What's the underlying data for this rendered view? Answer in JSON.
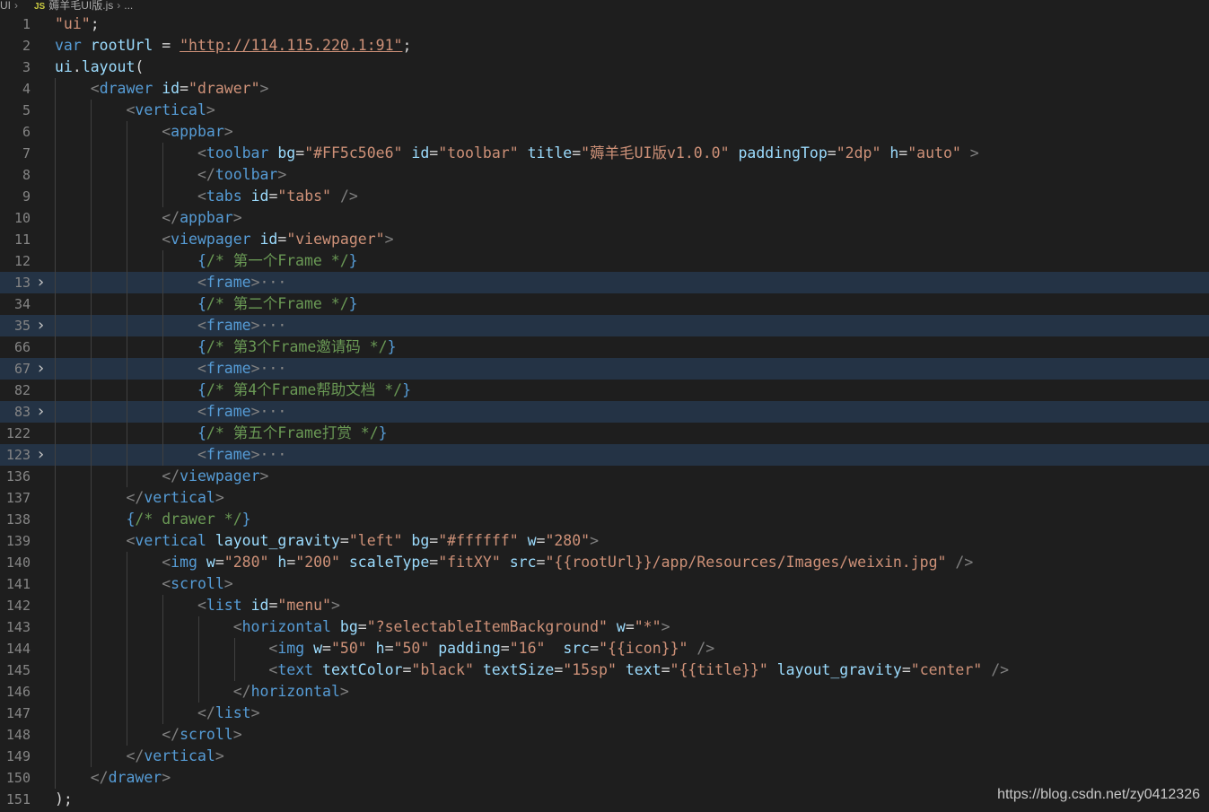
{
  "breadcrumb": {
    "root": "UI",
    "file_badge": "JS",
    "file": "薅羊毛UI版.js",
    "more": "..."
  },
  "colors": {
    "background": "#1e1e1e",
    "folded_line_bg": "#243345",
    "tag": "#569cd6",
    "attribute": "#9cdcfe",
    "string": "#ce9178",
    "comment": "#6a9955",
    "punctuation": "#808080"
  },
  "lines": [
    {
      "n": "1",
      "tokens": [
        [
          "st",
          "\"ui\""
        ],
        [
          "pl",
          ";"
        ]
      ]
    },
    {
      "n": "2",
      "tokens": [
        [
          "kw",
          "var"
        ],
        [
          "pl",
          " "
        ],
        [
          "vr",
          "rootUrl"
        ],
        [
          "pl",
          " = "
        ],
        [
          "st ul",
          "\"http://114.115.220.1:91\""
        ],
        [
          "pl",
          ";"
        ]
      ]
    },
    {
      "n": "3",
      "tokens": [
        [
          "vr",
          "ui"
        ],
        [
          "pl",
          "."
        ],
        [
          "vr",
          "layout"
        ],
        [
          "pl",
          "("
        ]
      ]
    },
    {
      "n": "4",
      "tokens": [
        [
          "pl",
          "    "
        ],
        [
          "tg",
          "<"
        ],
        [
          "tn",
          "drawer"
        ],
        [
          "pl",
          " "
        ],
        [
          "at",
          "id"
        ],
        [
          "pl",
          "="
        ],
        [
          "st",
          "\"drawer\""
        ],
        [
          "tg",
          ">"
        ]
      ]
    },
    {
      "n": "5",
      "tokens": [
        [
          "pl",
          "        "
        ],
        [
          "tg",
          "<"
        ],
        [
          "tn",
          "vertical"
        ],
        [
          "tg",
          ">"
        ]
      ]
    },
    {
      "n": "6",
      "tokens": [
        [
          "pl",
          "            "
        ],
        [
          "tg",
          "<"
        ],
        [
          "tn",
          "appbar"
        ],
        [
          "tg",
          ">"
        ]
      ]
    },
    {
      "n": "7",
      "tokens": [
        [
          "pl",
          "                "
        ],
        [
          "tg",
          "<"
        ],
        [
          "tn",
          "toolbar"
        ],
        [
          "pl",
          " "
        ],
        [
          "at",
          "bg"
        ],
        [
          "pl",
          "="
        ],
        [
          "st",
          "\"#FF5c50e6\""
        ],
        [
          "pl",
          " "
        ],
        [
          "at",
          "id"
        ],
        [
          "pl",
          "="
        ],
        [
          "st",
          "\"toolbar\""
        ],
        [
          "pl",
          " "
        ],
        [
          "at",
          "title"
        ],
        [
          "pl",
          "="
        ],
        [
          "st",
          "\"薅羊毛UI版v1.0.0\""
        ],
        [
          "pl",
          " "
        ],
        [
          "at",
          "paddingTop"
        ],
        [
          "pl",
          "="
        ],
        [
          "st",
          "\"2dp\""
        ],
        [
          "pl",
          " "
        ],
        [
          "at",
          "h"
        ],
        [
          "pl",
          "="
        ],
        [
          "st",
          "\"auto\""
        ],
        [
          "pl",
          " "
        ],
        [
          "tg",
          ">"
        ]
      ]
    },
    {
      "n": "8",
      "tokens": [
        [
          "pl",
          "                "
        ],
        [
          "tg",
          "</"
        ],
        [
          "tn",
          "toolbar"
        ],
        [
          "tg",
          ">"
        ]
      ]
    },
    {
      "n": "9",
      "tokens": [
        [
          "pl",
          "                "
        ],
        [
          "tg",
          "<"
        ],
        [
          "tn",
          "tabs"
        ],
        [
          "pl",
          " "
        ],
        [
          "at",
          "id"
        ],
        [
          "pl",
          "="
        ],
        [
          "st",
          "\"tabs\""
        ],
        [
          "pl",
          " "
        ],
        [
          "tg",
          "/>"
        ]
      ]
    },
    {
      "n": "10",
      "tokens": [
        [
          "pl",
          "            "
        ],
        [
          "tg",
          "</"
        ],
        [
          "tn",
          "appbar"
        ],
        [
          "tg",
          ">"
        ]
      ]
    },
    {
      "n": "11",
      "tokens": [
        [
          "pl",
          "            "
        ],
        [
          "tg",
          "<"
        ],
        [
          "tn",
          "viewpager"
        ],
        [
          "pl",
          " "
        ],
        [
          "at",
          "id"
        ],
        [
          "pl",
          "="
        ],
        [
          "st",
          "\"viewpager\""
        ],
        [
          "tg",
          ">"
        ]
      ]
    },
    {
      "n": "12",
      "tokens": [
        [
          "pl",
          "                "
        ],
        [
          "br",
          "{"
        ],
        [
          "cm",
          "/* 第一个Frame */"
        ],
        [
          "br",
          "}"
        ]
      ]
    },
    {
      "n": "13",
      "fold": true,
      "tokens": [
        [
          "pl",
          "                "
        ],
        [
          "tg",
          "<"
        ],
        [
          "tn",
          "frame"
        ],
        [
          "tg",
          ">"
        ],
        [
          "el",
          "···"
        ]
      ]
    },
    {
      "n": "34",
      "tokens": [
        [
          "pl",
          "                "
        ],
        [
          "br",
          "{"
        ],
        [
          "cm",
          "/* 第二个Frame */"
        ],
        [
          "br",
          "}"
        ]
      ]
    },
    {
      "n": "35",
      "fold": true,
      "tokens": [
        [
          "pl",
          "                "
        ],
        [
          "tg",
          "<"
        ],
        [
          "tn",
          "frame"
        ],
        [
          "tg",
          ">"
        ],
        [
          "el",
          "···"
        ]
      ]
    },
    {
      "n": "66",
      "tokens": [
        [
          "pl",
          "                "
        ],
        [
          "br",
          "{"
        ],
        [
          "cm",
          "/* 第3个Frame邀请码 */"
        ],
        [
          "br",
          "}"
        ]
      ]
    },
    {
      "n": "67",
      "fold": true,
      "tokens": [
        [
          "pl",
          "                "
        ],
        [
          "tg",
          "<"
        ],
        [
          "tn",
          "frame"
        ],
        [
          "tg",
          ">"
        ],
        [
          "el",
          "···"
        ]
      ]
    },
    {
      "n": "82",
      "tokens": [
        [
          "pl",
          "                "
        ],
        [
          "br",
          "{"
        ],
        [
          "cm",
          "/* 第4个Frame帮助文档 */"
        ],
        [
          "br",
          "}"
        ]
      ]
    },
    {
      "n": "83",
      "fold": true,
      "tokens": [
        [
          "pl",
          "                "
        ],
        [
          "tg",
          "<"
        ],
        [
          "tn",
          "frame"
        ],
        [
          "tg",
          ">"
        ],
        [
          "el",
          "···"
        ]
      ]
    },
    {
      "n": "122",
      "tokens": [
        [
          "pl",
          "                "
        ],
        [
          "br",
          "{"
        ],
        [
          "cm",
          "/* 第五个Frame打赏 */"
        ],
        [
          "br",
          "}"
        ]
      ]
    },
    {
      "n": "123",
      "fold": true,
      "tokens": [
        [
          "pl",
          "                "
        ],
        [
          "tg",
          "<"
        ],
        [
          "tn",
          "frame"
        ],
        [
          "tg",
          ">"
        ],
        [
          "el",
          "···"
        ]
      ]
    },
    {
      "n": "136",
      "tokens": [
        [
          "pl",
          "            "
        ],
        [
          "tg",
          "</"
        ],
        [
          "tn",
          "viewpager"
        ],
        [
          "tg",
          ">"
        ]
      ]
    },
    {
      "n": "137",
      "tokens": [
        [
          "pl",
          "        "
        ],
        [
          "tg",
          "</"
        ],
        [
          "tn",
          "vertical"
        ],
        [
          "tg",
          ">"
        ]
      ]
    },
    {
      "n": "138",
      "tokens": [
        [
          "pl",
          "        "
        ],
        [
          "br",
          "{"
        ],
        [
          "cm",
          "/* drawer */"
        ],
        [
          "br",
          "}"
        ]
      ]
    },
    {
      "n": "139",
      "tokens": [
        [
          "pl",
          "        "
        ],
        [
          "tg",
          "<"
        ],
        [
          "tn",
          "vertical"
        ],
        [
          "pl",
          " "
        ],
        [
          "at",
          "layout_gravity"
        ],
        [
          "pl",
          "="
        ],
        [
          "st",
          "\"left\""
        ],
        [
          "pl",
          " "
        ],
        [
          "at",
          "bg"
        ],
        [
          "pl",
          "="
        ],
        [
          "st",
          "\"#ffffff\""
        ],
        [
          "pl",
          " "
        ],
        [
          "at",
          "w"
        ],
        [
          "pl",
          "="
        ],
        [
          "st",
          "\"280\""
        ],
        [
          "tg",
          ">"
        ]
      ]
    },
    {
      "n": "140",
      "tokens": [
        [
          "pl",
          "            "
        ],
        [
          "tg",
          "<"
        ],
        [
          "tn",
          "img"
        ],
        [
          "pl",
          " "
        ],
        [
          "at",
          "w"
        ],
        [
          "pl",
          "="
        ],
        [
          "st",
          "\"280\""
        ],
        [
          "pl",
          " "
        ],
        [
          "at",
          "h"
        ],
        [
          "pl",
          "="
        ],
        [
          "st",
          "\"200\""
        ],
        [
          "pl",
          " "
        ],
        [
          "at",
          "scaleType"
        ],
        [
          "pl",
          "="
        ],
        [
          "st",
          "\"fitXY\""
        ],
        [
          "pl",
          " "
        ],
        [
          "at",
          "src"
        ],
        [
          "pl",
          "="
        ],
        [
          "st",
          "\"{{rootUrl}}/app/Resources/Images/weixin.jpg\""
        ],
        [
          "pl",
          " "
        ],
        [
          "tg",
          "/>"
        ]
      ]
    },
    {
      "n": "141",
      "tokens": [
        [
          "pl",
          "            "
        ],
        [
          "tg",
          "<"
        ],
        [
          "tn",
          "scroll"
        ],
        [
          "tg",
          ">"
        ]
      ]
    },
    {
      "n": "142",
      "tokens": [
        [
          "pl",
          "                "
        ],
        [
          "tg",
          "<"
        ],
        [
          "tn",
          "list"
        ],
        [
          "pl",
          " "
        ],
        [
          "at",
          "id"
        ],
        [
          "pl",
          "="
        ],
        [
          "st",
          "\"menu\""
        ],
        [
          "tg",
          ">"
        ]
      ]
    },
    {
      "n": "143",
      "tokens": [
        [
          "pl",
          "                    "
        ],
        [
          "tg",
          "<"
        ],
        [
          "tn",
          "horizontal"
        ],
        [
          "pl",
          " "
        ],
        [
          "at",
          "bg"
        ],
        [
          "pl",
          "="
        ],
        [
          "st",
          "\"?selectableItemBackground\""
        ],
        [
          "pl",
          " "
        ],
        [
          "at",
          "w"
        ],
        [
          "pl",
          "="
        ],
        [
          "st",
          "\"*\""
        ],
        [
          "tg",
          ">"
        ]
      ]
    },
    {
      "n": "144",
      "tokens": [
        [
          "pl",
          "                        "
        ],
        [
          "tg",
          "<"
        ],
        [
          "tn",
          "img"
        ],
        [
          "pl",
          " "
        ],
        [
          "at",
          "w"
        ],
        [
          "pl",
          "="
        ],
        [
          "st",
          "\"50\""
        ],
        [
          "pl",
          " "
        ],
        [
          "at",
          "h"
        ],
        [
          "pl",
          "="
        ],
        [
          "st",
          "\"50\""
        ],
        [
          "pl",
          " "
        ],
        [
          "at",
          "padding"
        ],
        [
          "pl",
          "="
        ],
        [
          "st",
          "\"16\""
        ],
        [
          "pl",
          "  "
        ],
        [
          "at",
          "src"
        ],
        [
          "pl",
          "="
        ],
        [
          "st",
          "\"{{icon}}\""
        ],
        [
          "pl",
          " "
        ],
        [
          "tg",
          "/>"
        ]
      ]
    },
    {
      "n": "145",
      "tokens": [
        [
          "pl",
          "                        "
        ],
        [
          "tg",
          "<"
        ],
        [
          "tn",
          "text"
        ],
        [
          "pl",
          " "
        ],
        [
          "at",
          "textColor"
        ],
        [
          "pl",
          "="
        ],
        [
          "st",
          "\"black\""
        ],
        [
          "pl",
          " "
        ],
        [
          "at",
          "textSize"
        ],
        [
          "pl",
          "="
        ],
        [
          "st",
          "\"15sp\""
        ],
        [
          "pl",
          " "
        ],
        [
          "at",
          "text"
        ],
        [
          "pl",
          "="
        ],
        [
          "st",
          "\"{{title}}\""
        ],
        [
          "pl",
          " "
        ],
        [
          "at",
          "layout_gravity"
        ],
        [
          "pl",
          "="
        ],
        [
          "st",
          "\"center\""
        ],
        [
          "pl",
          " "
        ],
        [
          "tg",
          "/>"
        ]
      ]
    },
    {
      "n": "146",
      "tokens": [
        [
          "pl",
          "                    "
        ],
        [
          "tg",
          "</"
        ],
        [
          "tn",
          "horizontal"
        ],
        [
          "tg",
          ">"
        ]
      ]
    },
    {
      "n": "147",
      "tokens": [
        [
          "pl",
          "                "
        ],
        [
          "tg",
          "</"
        ],
        [
          "tn",
          "list"
        ],
        [
          "tg",
          ">"
        ]
      ]
    },
    {
      "n": "148",
      "tokens": [
        [
          "pl",
          "            "
        ],
        [
          "tg",
          "</"
        ],
        [
          "tn",
          "scroll"
        ],
        [
          "tg",
          ">"
        ]
      ]
    },
    {
      "n": "149",
      "tokens": [
        [
          "pl",
          "        "
        ],
        [
          "tg",
          "</"
        ],
        [
          "tn",
          "vertical"
        ],
        [
          "tg",
          ">"
        ]
      ]
    },
    {
      "n": "150",
      "tokens": [
        [
          "pl",
          "    "
        ],
        [
          "tg",
          "</"
        ],
        [
          "tn",
          "drawer"
        ],
        [
          "tg",
          ">"
        ]
      ]
    },
    {
      "n": "151",
      "tokens": [
        [
          "pl",
          ");"
        ]
      ]
    }
  ],
  "watermark": "https://blog.csdn.net/zy0412326"
}
